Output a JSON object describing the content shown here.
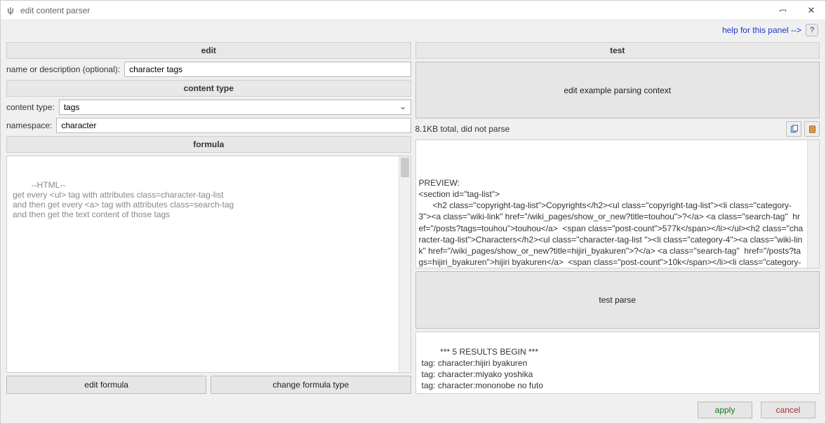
{
  "window": {
    "title": "edit content parser"
  },
  "help": {
    "link_text": "help for this panel -->"
  },
  "left": {
    "edit_header": "edit",
    "name_label": "name or description (optional):",
    "name_value": "character tags",
    "content_type_header": "content type",
    "content_type_label": "content type:",
    "content_type_value": "tags",
    "namespace_label": "namespace:",
    "namespace_value": "character",
    "formula_header": "formula",
    "formula_text": "--HTML--\nget every <ul> tag with attributes class=character-tag-list\nand then get every <a> tag with attributes class=search-tag\nand then get the text content of those tags",
    "edit_formula_btn": "edit formula",
    "change_formula_btn": "change formula type"
  },
  "right": {
    "test_header": "test",
    "edit_context_btn": "edit example parsing context",
    "status_text": "8.1KB total, did not parse",
    "preview_text": "PREVIEW:\n<section id=\"tag-list\">\n      <h2 class=\"copyright-tag-list\">Copyrights</h2><ul class=\"copyright-tag-list\"><li class=\"category-3\"><a class=\"wiki-link\" href=\"/wiki_pages/show_or_new?title=touhou\">?</a> <a class=\"search-tag\"  href=\"/posts?tags=touhou\">touhou</a>  <span class=\"post-count\">577k</span></li></ul><h2 class=\"character-tag-list\">Characters</h2><ul class=\"character-tag-list \"><li class=\"category-4\"><a class=\"wiki-link\" href=\"/wiki_pages/show_or_new?title=hijiri_byakuren\">?</a> <a class=\"search-tag\"  href=\"/posts?tags=hijiri_byakuren\">hijiri byakuren</a>  <span class=\"post-count\">10k</span></li><li class=\"category-4\"><a class=\"wiki-link\" href=\"/wiki_pages/show_or_new?title=miyako_yoshika\">?</a> <a class=\"search-tag\"  href=\"/posts?tags=miyako_yoshika\">miyako yoshika</a>  <span class=\"post-count\">3.9k</span></li><li class=\"category-4\"><a class=\"wiki-link\"",
    "test_parse_btn": "test parse",
    "results_text": "*** 5 RESULTS BEGIN ***\ntag: character:hijiri byakuren\ntag: character:miyako yoshika\ntag: character:mononobe no futo\ntag: character:soga no tojiko\ntag: character:toyosatomimi no miko\n*** RESULTS END ***"
  },
  "footer": {
    "apply": "apply",
    "cancel": "cancel"
  }
}
